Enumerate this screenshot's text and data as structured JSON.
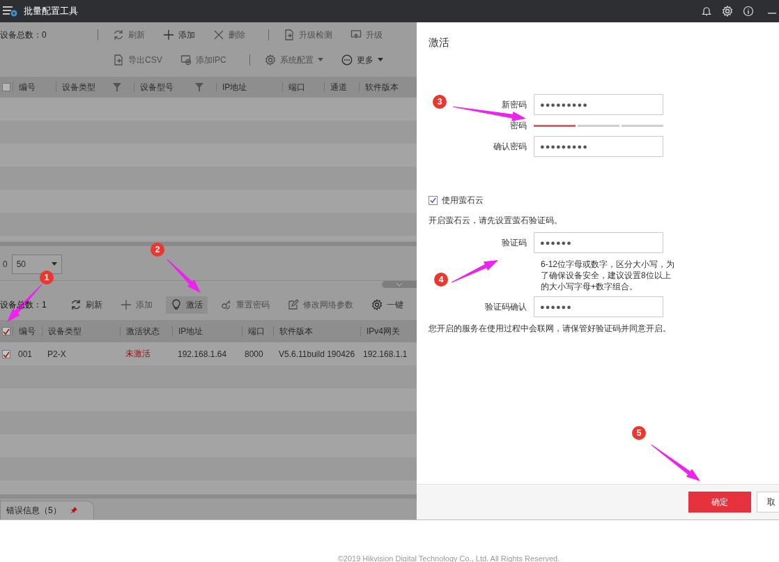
{
  "window": {
    "title": "批量配置工具"
  },
  "online_devices": {
    "count_label": "设备总数：0",
    "toolbar": [
      {
        "label": "刷新",
        "disabled": true
      },
      {
        "label": "添加",
        "disabled": false
      },
      {
        "label": "删除",
        "disabled": true
      },
      {
        "label": "升级检测",
        "disabled": true
      },
      {
        "label": "升级",
        "disabled": true
      },
      {
        "label": "导出CSV",
        "disabled": true
      },
      {
        "label": "添加IPC",
        "disabled": true
      },
      {
        "label": "系统配置",
        "disabled": true
      },
      {
        "label": "更多",
        "disabled": false
      }
    ],
    "header_checked": false,
    "columns": [
      "编号",
      "设备类型",
      "设备型号",
      "IP地址",
      "端口",
      "通道",
      "软件版本"
    ],
    "page_prefix": "0",
    "page_size": "50"
  },
  "scanned_devices": {
    "count_label": "设备总数：1",
    "toolbar": [
      {
        "label": "刷新",
        "disabled": false,
        "selected": false
      },
      {
        "label": "添加",
        "disabled": true,
        "selected": false
      },
      {
        "label": "激活",
        "disabled": false,
        "selected": true
      },
      {
        "label": "重置密码",
        "disabled": true,
        "selected": false
      },
      {
        "label": "修改网络参数",
        "disabled": true,
        "selected": false
      },
      {
        "label": "一键",
        "disabled": false,
        "selected": false
      }
    ],
    "header_checked": true,
    "columns": [
      "编号",
      "设备类型",
      "激活状态",
      "IP地址",
      "端口",
      "软件版本",
      "IPv4网关"
    ],
    "rows": [
      {
        "checked": true,
        "cells": [
          "001",
          "P2-X",
          "未激活",
          "192.168.1.64",
          "8000",
          "V5.6.11build 190426",
          "192.168.1.1"
        ]
      }
    ]
  },
  "error_tab": {
    "label": "错误信息（5）"
  },
  "activate_panel": {
    "title": "激活",
    "new_password": {
      "label": "新密码",
      "value": "●●●●●●●●●"
    },
    "strength": {
      "label": "密码",
      "level": 0.33
    },
    "confirm_password": {
      "label": "确认密码",
      "value": "●●●●●●●●●"
    },
    "cloud": {
      "label": "使用萤石云",
      "checked": true
    },
    "cloud_note": "开启萤石云，请先设置萤石验证码。",
    "code": {
      "label": "验证码",
      "value": "●●●●●●"
    },
    "code_hint": "6-12位字母或数字，区分大小写，为了确保设备安全，建议设置8位以上的大小写字母+数字组合。",
    "code_confirm": {
      "label": "验证码确认",
      "value": "●●●●●●"
    },
    "service_note": "您开启的服务在使用过程中会联网，请保管好验证码并同意开启。",
    "buttons": [
      {
        "label": "确定",
        "kind": "primary"
      },
      {
        "label": "取",
        "kind": "secondary"
      }
    ]
  },
  "annotations": [
    {
      "number": "1"
    },
    {
      "number": "2"
    },
    {
      "number": "3"
    },
    {
      "number": "4"
    },
    {
      "number": "5"
    }
  ],
  "footer": {
    "copyright": "©2019 Hikvision Digital Technology Co., Ltd. All Rights Reserved."
  }
}
